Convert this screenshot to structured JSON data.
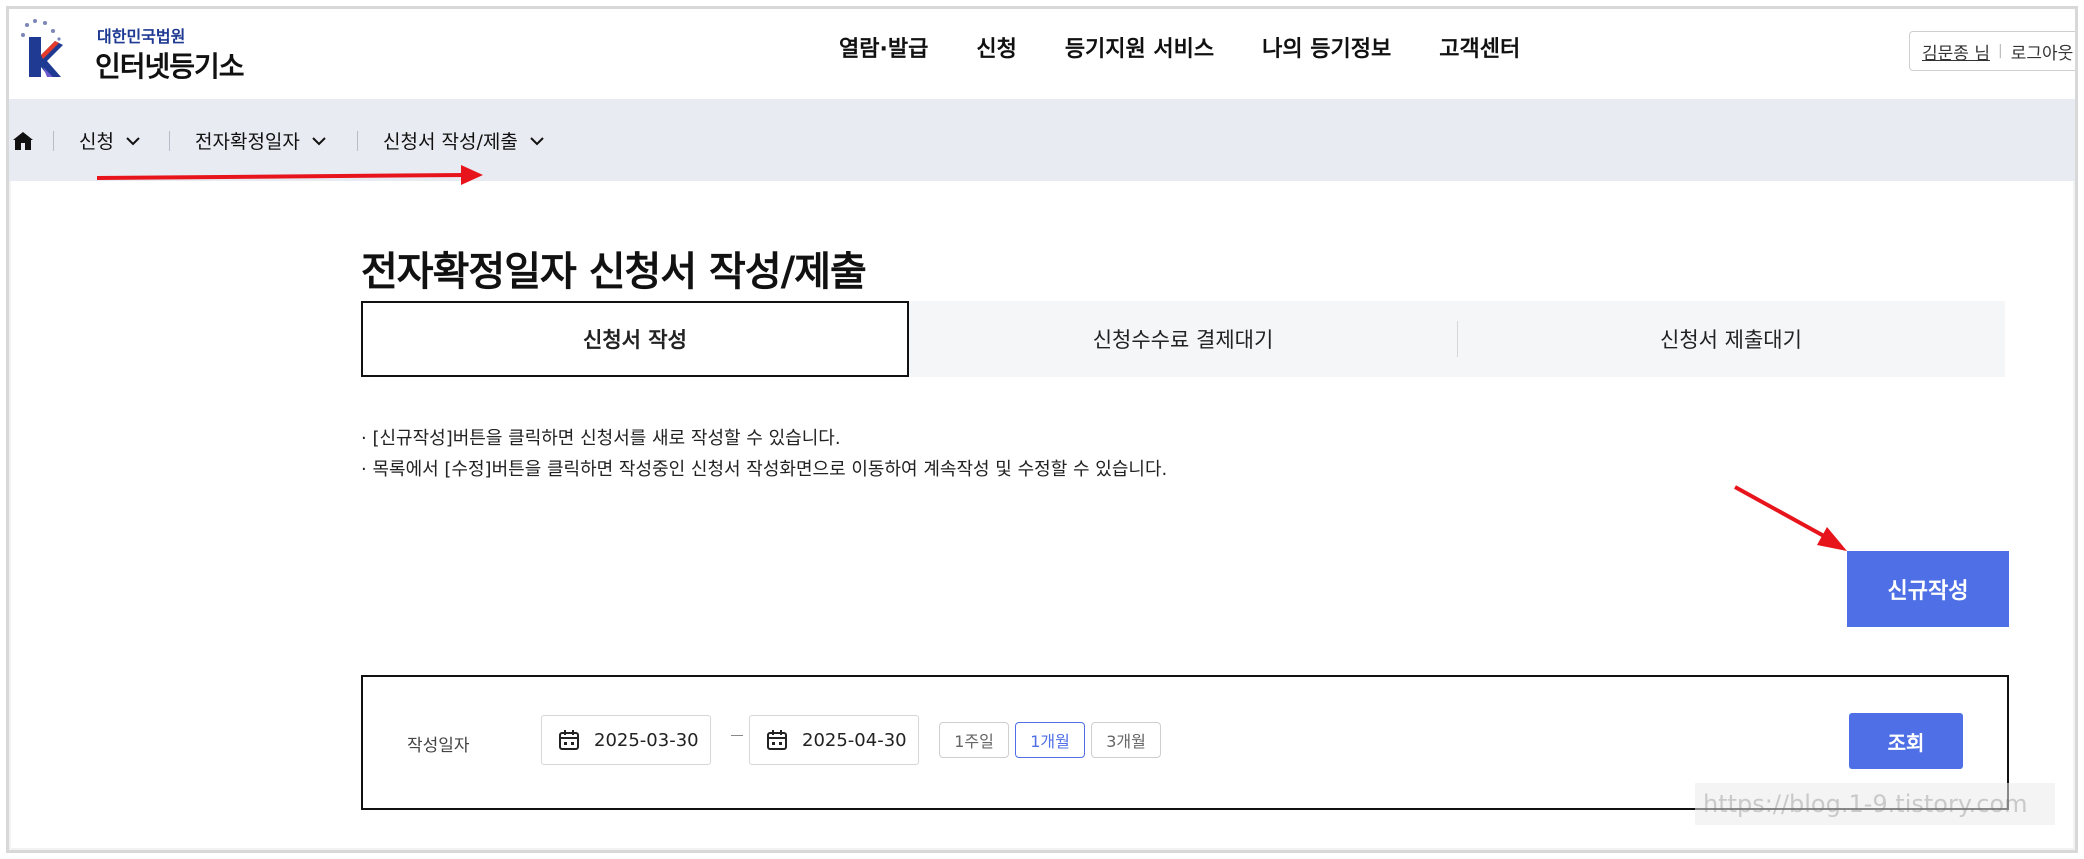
{
  "header": {
    "logo_sub": "대한민국법원",
    "logo_main": "인터넷등기소",
    "nav": [
      "열람·발급",
      "신청",
      "등기지원 서비스",
      "나의 등기정보",
      "고객센터"
    ],
    "user_name": "김문종 님",
    "logout": "로그아웃"
  },
  "breadcrumb": {
    "home_icon": "home-icon",
    "items": [
      "신청",
      "전자확정일자",
      "신청서 작성/제출"
    ]
  },
  "main": {
    "title": "전자확정일자 신청서 작성/제출",
    "tabs": [
      {
        "label": "신청서 작성",
        "active": true
      },
      {
        "label": "신청수수료 결제대기",
        "active": false
      },
      {
        "label": "신청서 제출대기",
        "active": false
      }
    ],
    "notes": [
      "· [신규작성]버튼을 클릭하면 신청서를 새로 작성할 수 있습니다.",
      "· 목록에서 [수정]버튼을 클릭하면 작성중인 신청서 작성화면으로 이동하여 계속작성 및 수정할 수 있습니다."
    ],
    "new_button": "신규작성"
  },
  "search": {
    "label": "작성일자",
    "date_from": "2025-03-30",
    "date_to": "2025-04-30",
    "periods": [
      "1주일",
      "1개월",
      "3개월"
    ],
    "active_period": "1개월",
    "search_button": "조회"
  },
  "watermark": "https://blog.1-9.tistory.com",
  "colors": {
    "accent": "#4f6fe6",
    "lnb_bg": "#e9ebf2",
    "annotation": "#e8141c"
  }
}
